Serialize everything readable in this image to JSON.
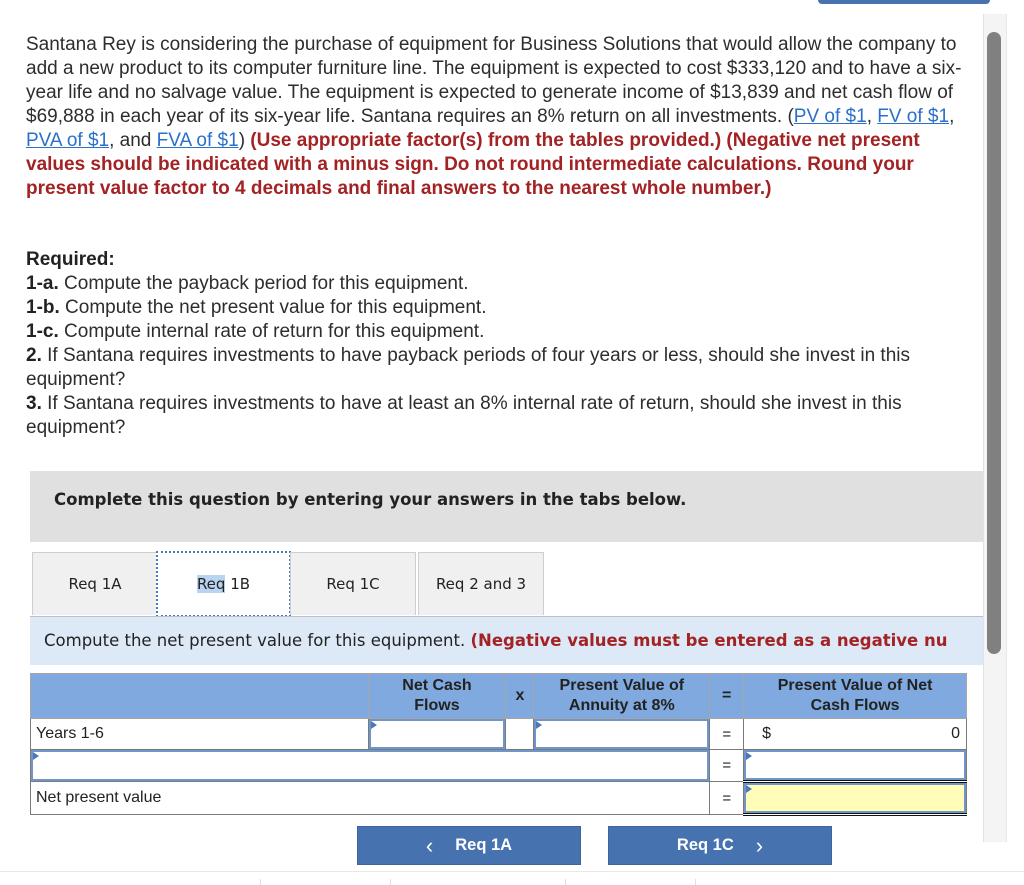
{
  "question": {
    "text_1": "Santana Rey is considering the purchase of equipment for Business Solutions that would allow the company to add a new product to its computer furniture line. The equipment is expected to cost $333,120 and to have a six-year life and no salvage value. The equipment is expected to generate income of $13,839 and net cash flow of $69,888 in each year of its six-year life. Santana requires an 8% return on all investments. (",
    "links": [
      "PV of $1",
      "FV of $1",
      "PVA of $1",
      "FVA of $1"
    ],
    "sep_1": ", ",
    "sep_2": ", ",
    "sep_3": ", and ",
    "close": ") ",
    "instructions": "(Use appropriate factor(s) from the tables provided.) (Negative net present values should be indicated with a minus sign. Do not round intermediate calculations. Round your present value factor to 4 decimals and final answers to the nearest whole number.)"
  },
  "required": {
    "heading": "Required:",
    "items": [
      {
        "num": "1-a.",
        "text": " Compute the payback period for this equipment."
      },
      {
        "num": "1-b.",
        "text": " Compute the net present value for this equipment."
      },
      {
        "num": "1-c.",
        "text": " Compute internal rate of return for this equipment."
      },
      {
        "num": "2.",
        "text": " If Santana requires investments to have payback periods of four years or less, should she invest in this equipment?"
      },
      {
        "num": "3.",
        "text": " If Santana requires investments to have at least an 8% internal rate of return, should she invest in this equipment?"
      }
    ]
  },
  "banner": "Complete this question by entering your answers in the tabs below.",
  "tabs": [
    {
      "label": "Req 1A",
      "active": false
    },
    {
      "label_hl": "Req",
      "label_rest": " 1B",
      "label": "Req 1B",
      "active": true
    },
    {
      "label": "Req 1C",
      "active": false
    },
    {
      "label": "Req 2 and 3",
      "active": false
    }
  ],
  "instruction_bar": {
    "text": "Compute the net present value for this equipment. ",
    "red": "(Negative values must be entered as a negative nu"
  },
  "table": {
    "headers": {
      "blank": "",
      "net_cash_flows": "Net Cash Flows",
      "times": "x",
      "pv_annuity": "Present Value of Annuity at 8%",
      "equals": "=",
      "pv_net_cash_flows": "Present Value of Net Cash Flows"
    },
    "rows": [
      {
        "label": "Years 1-6",
        "net_cash_flow": "",
        "factor": "",
        "equals": "=",
        "currency": "$",
        "result": "0"
      },
      {
        "label": "",
        "equals": "=",
        "result": ""
      },
      {
        "label": "Net present value",
        "equals": "=",
        "result": ""
      }
    ]
  },
  "nav": {
    "prev_label": "Req 1A",
    "next_label": "Req 1C",
    "prev_icon": "‹",
    "next_icon": "›"
  },
  "colors": {
    "header_blue": "#80aadf",
    "button_blue": "#4672b0",
    "instruction_red": "#a32224",
    "highlight_yellow": "#fffdb8"
  }
}
